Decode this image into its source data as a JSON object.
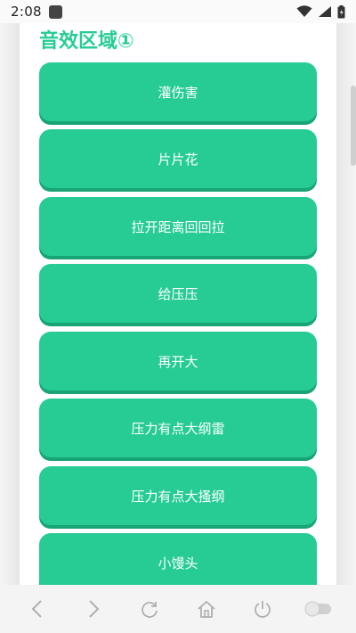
{
  "status_bar": {
    "time": "2:08"
  },
  "section": {
    "title": "音效区域①"
  },
  "sound_buttons": [
    {
      "label": "灌伤害"
    },
    {
      "label": "片片花"
    },
    {
      "label": "拉开距离回回拉"
    },
    {
      "label": "给压压"
    },
    {
      "label": "再开大"
    },
    {
      "label": "压力有点大纲雷"
    },
    {
      "label": "压力有点大搔纲"
    },
    {
      "label": "小馒头"
    }
  ],
  "theme": {
    "accent": "#26cc94",
    "accent_shadow": "#18a473"
  },
  "nav_icons": [
    "back-icon",
    "forward-icon",
    "refresh-icon",
    "home-icon",
    "power-icon",
    "toggle-icon"
  ]
}
